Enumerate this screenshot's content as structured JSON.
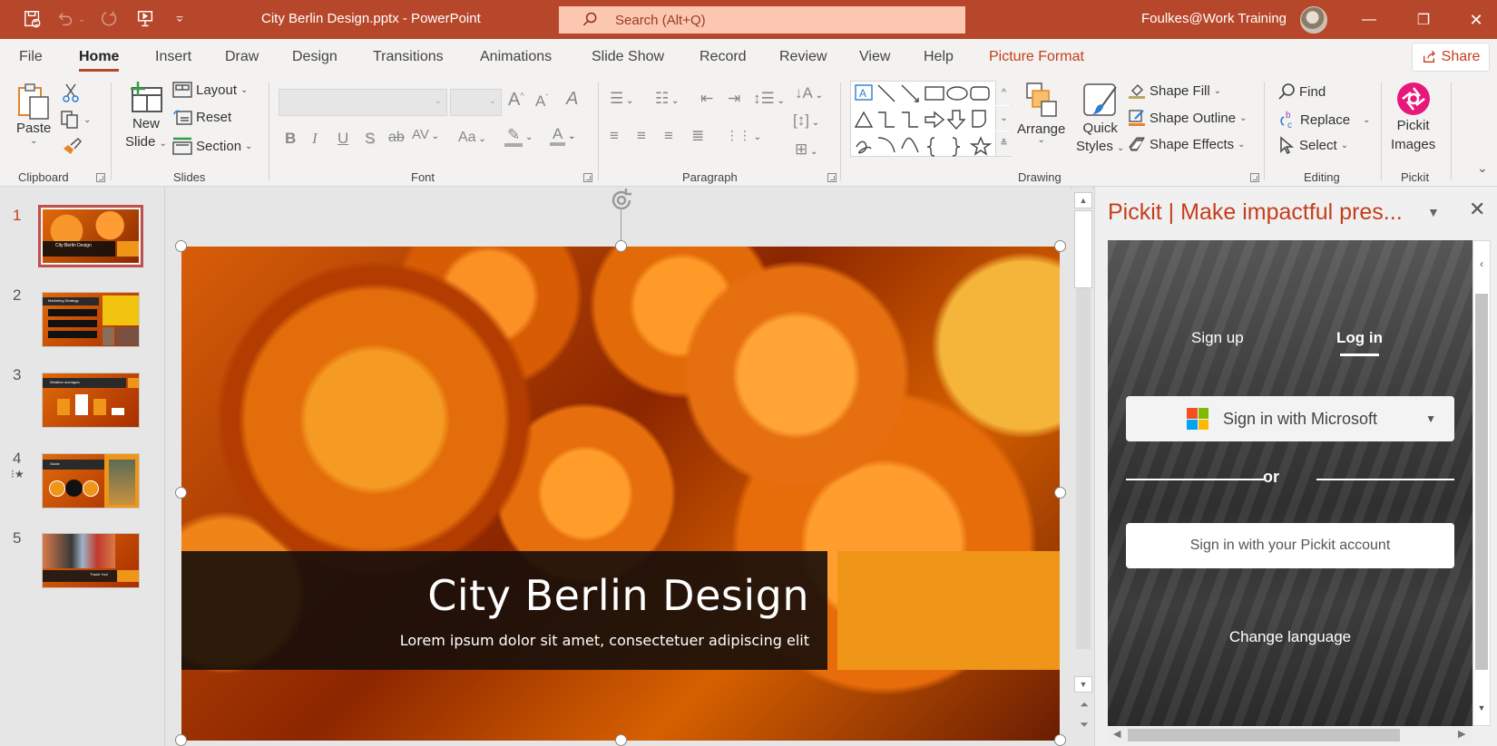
{
  "titlebar": {
    "file_title": "City Berlin Design.pptx  -  PowerPoint",
    "search_placeholder": "Search (Alt+Q)",
    "account_name": "Foulkes@Work Training",
    "quick_access": [
      "autosave-icon",
      "undo-icon",
      "redo-icon",
      "present-icon",
      "customize-icon"
    ],
    "window_controls": {
      "minimize": "—",
      "restore": "❐",
      "close": "✕"
    }
  },
  "tabs": [
    {
      "label": "File"
    },
    {
      "label": "Home",
      "active": true
    },
    {
      "label": "Insert"
    },
    {
      "label": "Draw"
    },
    {
      "label": "Design"
    },
    {
      "label": "Transitions"
    },
    {
      "label": "Animations"
    },
    {
      "label": "Slide Show"
    },
    {
      "label": "Record"
    },
    {
      "label": "Review"
    },
    {
      "label": "View"
    },
    {
      "label": "Help"
    },
    {
      "label": "Picture Format",
      "contextual": true
    }
  ],
  "share_label": "Share",
  "ribbon": {
    "clipboard": {
      "label": "Clipboard",
      "paste": "Paste"
    },
    "slides": {
      "label": "Slides",
      "new_slide_1": "New",
      "new_slide_2": "Slide",
      "layout": "Layout",
      "reset": "Reset",
      "section": "Section"
    },
    "font": {
      "label": "Font",
      "font_name": "",
      "font_size": ""
    },
    "paragraph": {
      "label": "Paragraph"
    },
    "drawing": {
      "label": "Drawing",
      "arrange": "Arrange",
      "quick_styles_1": "Quick",
      "quick_styles_2": "Styles",
      "shape_fill": "Shape Fill",
      "shape_outline": "Shape Outline",
      "shape_effects": "Shape Effects"
    },
    "editing": {
      "label": "Editing",
      "find": "Find",
      "replace": "Replace",
      "select": "Select"
    },
    "pickit": {
      "label": "Pickit",
      "button_1": "Pickit",
      "button_2": "Images"
    }
  },
  "slides": [
    {
      "number": "1",
      "active": true
    },
    {
      "number": "2"
    },
    {
      "number": "3"
    },
    {
      "number": "4",
      "has_animation": true
    },
    {
      "number": "5"
    }
  ],
  "thumbnail_text": {
    "s1_title": "City Berlin Design",
    "s2_title": "Marketing Strategy",
    "s3_title": "Weather averages",
    "s4_title": "Guide",
    "s5_title": "Thank You!"
  },
  "slide": {
    "title": "City Berlin Design",
    "subtitle": "Lorem ipsum dolor sit amet, consectetuer adipiscing elit",
    "accent_color": "#ef9518"
  },
  "taskpane": {
    "title": "Pickit | Make impactful pres...",
    "tab_signup": "Sign up",
    "tab_login": "Log in",
    "ms_signin": "Sign in with Microsoft",
    "or": "or",
    "pickit_signin": "Sign in with your Pickit account",
    "change_language": "Change language"
  },
  "colors": {
    "brand": "#b7472a",
    "contextual_tab": "#c43e1c",
    "pickit_pink": "#e6197a"
  }
}
